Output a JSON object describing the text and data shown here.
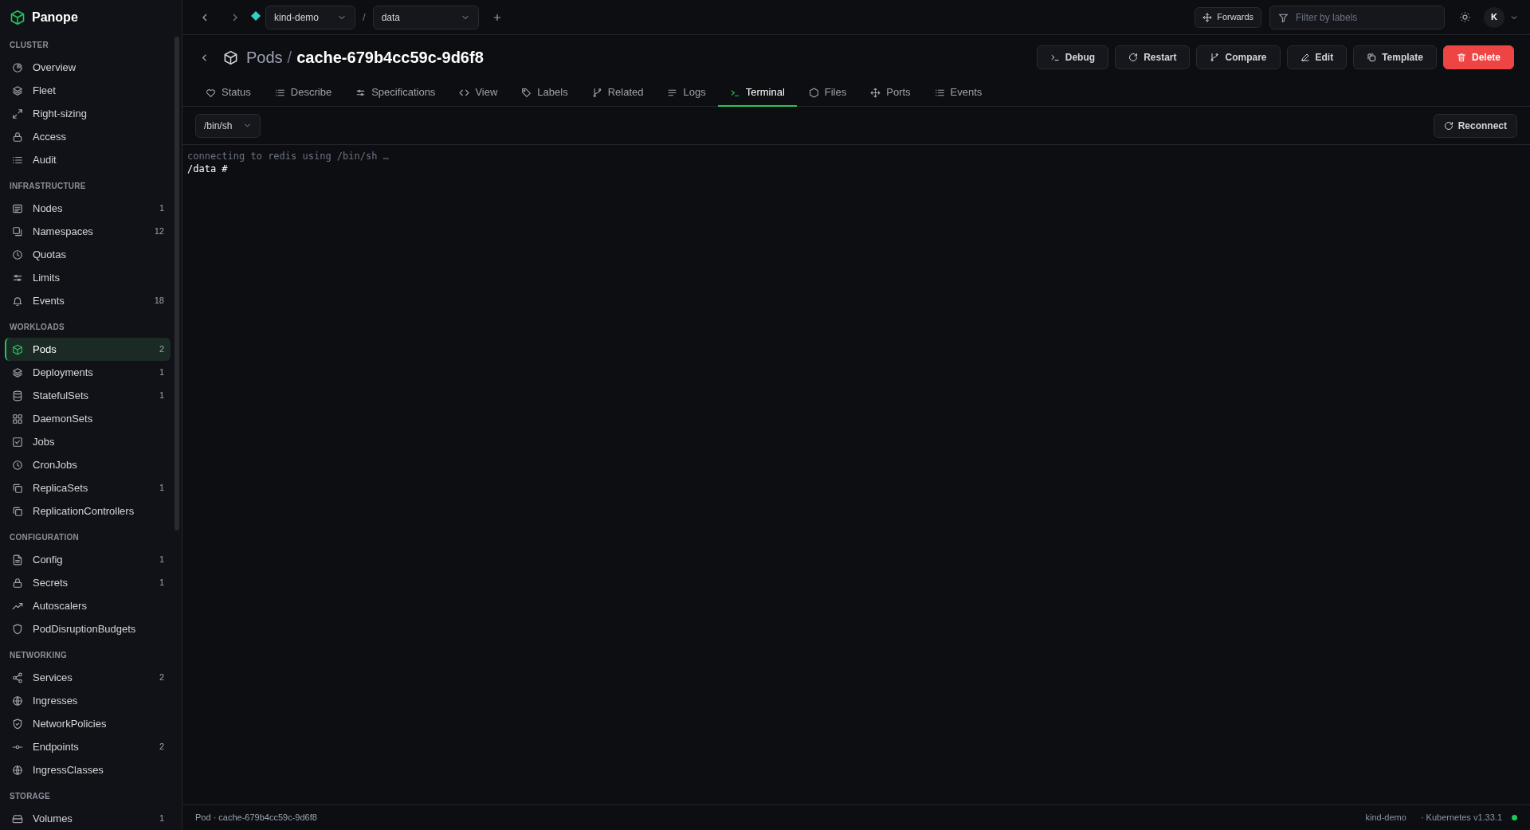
{
  "app": {
    "name": "Panope"
  },
  "sidebar": {
    "sections": [
      {
        "title": "CLUSTER",
        "items": [
          {
            "label": "Overview",
            "selected": false
          },
          {
            "label": "Fleet",
            "selected": false
          },
          {
            "label": "Right-sizing",
            "selected": false
          },
          {
            "label": "Access",
            "selected": false
          },
          {
            "label": "Audit",
            "selected": false
          }
        ]
      },
      {
        "title": "INFRASTRUCTURE",
        "items": [
          {
            "label": "Nodes",
            "count": "1",
            "selected": false
          },
          {
            "label": "Namespaces",
            "count": "12",
            "selected": false
          },
          {
            "label": "Quotas",
            "selected": false
          },
          {
            "label": "Limits",
            "selected": false
          },
          {
            "label": "Events",
            "count": "18",
            "selected": false
          }
        ]
      },
      {
        "title": "WORKLOADS",
        "items": [
          {
            "label": "Pods",
            "count": "2",
            "selected": true
          },
          {
            "label": "Deployments",
            "count": "1",
            "selected": false
          },
          {
            "label": "StatefulSets",
            "count": "1",
            "selected": false
          },
          {
            "label": "DaemonSets",
            "selected": false
          },
          {
            "label": "Jobs",
            "selected": false
          },
          {
            "label": "CronJobs",
            "selected": false
          },
          {
            "label": "ReplicaSets",
            "count": "1",
            "selected": false
          },
          {
            "label": "ReplicationControllers",
            "selected": false
          }
        ]
      },
      {
        "title": "CONFIGURATION",
        "items": [
          {
            "label": "Config",
            "count": "1",
            "selected": false
          },
          {
            "label": "Secrets",
            "count": "1",
            "selected": false
          },
          {
            "label": "Autoscalers",
            "selected": false
          },
          {
            "label": "PodDisruptionBudgets",
            "selected": false
          }
        ]
      },
      {
        "title": "NETWORKING",
        "items": [
          {
            "label": "Services",
            "count": "2",
            "selected": false
          },
          {
            "label": "Ingresses",
            "selected": false
          },
          {
            "label": "NetworkPolicies",
            "selected": false
          },
          {
            "label": "Endpoints",
            "count": "2",
            "selected": false
          },
          {
            "label": "IngressClasses",
            "selected": false
          }
        ]
      },
      {
        "title": "STORAGE",
        "items": [
          {
            "label": "Volumes",
            "count": "1",
            "selected": false
          }
        ]
      }
    ]
  },
  "topbar": {
    "cluster": "kind-demo",
    "separator": "/",
    "namespace": "data",
    "forwards": "Forwards",
    "filter_placeholder": "Filter by labels",
    "avatar": "K"
  },
  "header": {
    "parent": "Pods",
    "separator": "/",
    "name": "cache-679b4cc59c-9d6f8",
    "actions": [
      {
        "label": "Debug",
        "kind": "default"
      },
      {
        "label": "Restart",
        "kind": "default"
      },
      {
        "label": "Compare",
        "kind": "default"
      },
      {
        "label": "Edit",
        "kind": "default"
      },
      {
        "label": "Template",
        "kind": "default"
      },
      {
        "label": "Delete",
        "kind": "danger"
      }
    ]
  },
  "tabs": [
    {
      "label": "Status",
      "selected": false
    },
    {
      "label": "Describe",
      "selected": false
    },
    {
      "label": "Specifications",
      "selected": false
    },
    {
      "label": "View",
      "selected": false
    },
    {
      "label": "Labels",
      "selected": false
    },
    {
      "label": "Related",
      "selected": false
    },
    {
      "label": "Logs",
      "selected": false
    },
    {
      "label": "Terminal",
      "selected": true
    },
    {
      "label": "Files",
      "selected": false
    },
    {
      "label": "Ports",
      "selected": false
    },
    {
      "label": "Events",
      "selected": false
    }
  ],
  "terminal": {
    "shell": "/bin/sh",
    "reconnect": "Reconnect",
    "lines": [
      {
        "text": "connecting to redis using /bin/sh …",
        "kind": "info"
      },
      {
        "text": "/data #",
        "kind": "prompt"
      }
    ]
  },
  "status_bar": {
    "resource": "Pod · cache-679b4cc59c-9d6f8",
    "cluster": "kind-demo",
    "version": "· Kubernetes v1.33.1",
    "connected": true
  }
}
